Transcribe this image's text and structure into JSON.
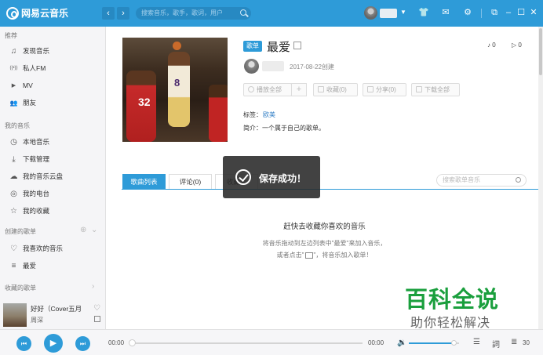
{
  "app": {
    "name": "网易云音乐"
  },
  "colors": {
    "accent": "#2e9bd8",
    "titlebar": "#2e9bd8",
    "watermark_green": "#1a9f3d"
  },
  "titlebar": {
    "back_icon": "‹",
    "forward_icon": "›",
    "search_placeholder": "搜索音乐，歌手，歌词，用户",
    "dropdown_icon": "▼",
    "icons": [
      "shirt-icon",
      "mail-icon",
      "gear-icon",
      "mini-mode-icon",
      "minimize-icon",
      "maximize-icon",
      "close-icon"
    ]
  },
  "sidebar": {
    "section_recommend": "推荐",
    "recommend_items": [
      {
        "label": "发现音乐",
        "icon": "♫"
      },
      {
        "label": "私人FM",
        "icon": "((•))"
      },
      {
        "label": "MV",
        "icon": "▶"
      },
      {
        "label": "朋友",
        "icon": "👥"
      }
    ],
    "section_my_music": "我的音乐",
    "my_music_items": [
      {
        "label": "本地音乐",
        "icon": "◷"
      },
      {
        "label": "下载管理",
        "icon": "⤓"
      },
      {
        "label": "我的音乐云盘",
        "icon": "☁"
      },
      {
        "label": "我的电台",
        "icon": "◎"
      },
      {
        "label": "我的收藏",
        "icon": "☆"
      }
    ],
    "section_created": "创建的歌单",
    "created_items": [
      {
        "label": "我喜欢的音乐",
        "icon": "♡"
      },
      {
        "label": "最爱",
        "icon": "≡"
      }
    ],
    "section_collected": "收藏的歌单",
    "now_playing": {
      "title": "好好（Cover五月",
      "artist": "周深"
    }
  },
  "playlist": {
    "tag": "歌单",
    "title": "最爱",
    "song_count": "0",
    "play_count": "0",
    "created_date": "2017-08-22创建",
    "actions": {
      "play_all": "播放全部",
      "add": "+",
      "collect": "收藏(0)",
      "share": "分享(0)",
      "download_all": "下载全部"
    },
    "tags_label": "标签：",
    "tags_value": "欧美",
    "intro": "简介：一个属于自己的歌单。",
    "cover_jersey_main": "8",
    "cover_jersey_left": "32"
  },
  "tabs": [
    {
      "label": "歌曲列表",
      "active": true
    },
    {
      "label": "评论(0)",
      "active": false
    },
    {
      "label": "收藏者",
      "active": false
    }
  ],
  "playlist_search_placeholder": "搜索歌单音乐",
  "toast": {
    "message": "保存成功！"
  },
  "empty_state": {
    "title": "赶快去收藏你喜欢的音乐",
    "line1": "将音乐拖动到左边列表中\"最爱\"来加入音乐，",
    "line2_before": "或者点击\"",
    "line2_after": "\"，将音乐加入歌单！"
  },
  "watermark": {
    "big": "百科全说",
    "small": "助你轻松解决"
  },
  "player": {
    "current_time": "00:00",
    "total_time": "00:00",
    "progress": 0,
    "volume": 0.9,
    "playlist_count": "30"
  }
}
